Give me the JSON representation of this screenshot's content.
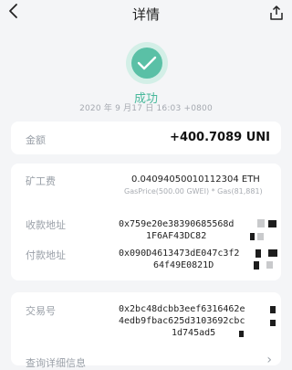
{
  "header": {
    "title": "详情",
    "back_icon": "back-arrow-icon",
    "share_icon": "share-icon"
  },
  "status": {
    "icon": "check-icon",
    "text": "成功",
    "time": "2020 年 9 月17 日 16:03 +0800",
    "color": "#48b89b"
  },
  "amount": {
    "label": "金额",
    "value": "+400.7089 UNI"
  },
  "fee": {
    "label": "矿工费",
    "value": "0.04094050010112304 ETH",
    "sub": "GasPrice(500.00 GWEI) * Gas(81,881)"
  },
  "receive": {
    "label": "收款地址",
    "line1": "0x759e20e38390685568d",
    "line2": "1F6AF43DC82"
  },
  "pay": {
    "label": "付款地址",
    "line1": "0x090D4613473dE047c3f2",
    "line2": "64f49E0821D"
  },
  "tx": {
    "label": "交易号",
    "line1": "0x2bc48dcbb3eef6316462e",
    "line2": "4edb9fbac625d3103692cbc",
    "line3": "1d745ad5"
  },
  "detail": {
    "label": "查询详细信息",
    "arrow": "›"
  }
}
